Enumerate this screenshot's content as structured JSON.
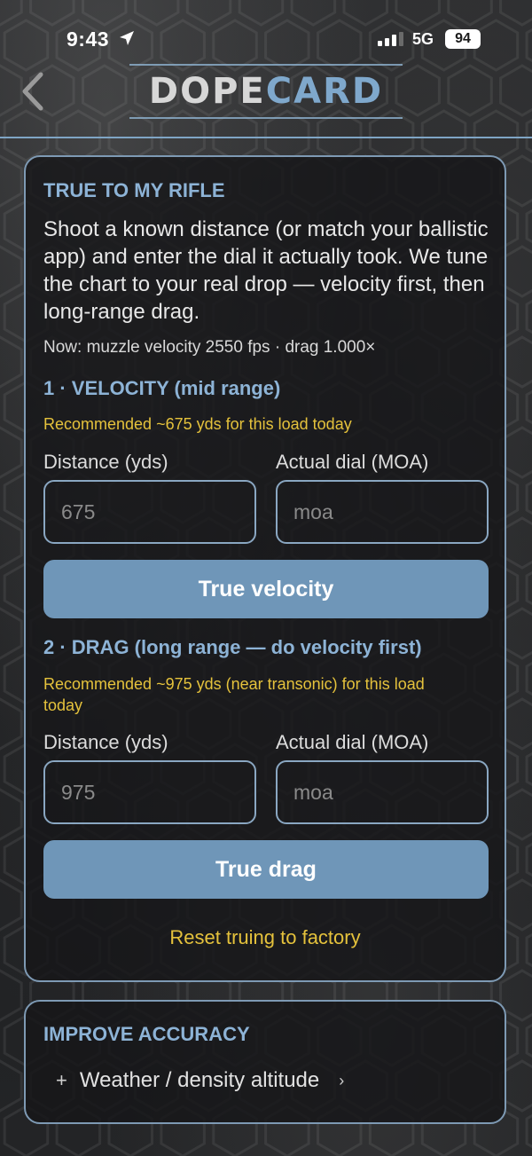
{
  "status_bar": {
    "time": "9:43",
    "network": "5G",
    "battery": "94"
  },
  "header": {
    "logo_part1": "DOPE",
    "logo_part2": "CARD"
  },
  "true_to_rifle": {
    "title": "TRUE TO MY RIFLE",
    "intro": "Shoot a known distance (or match your ballistic app) and enter the dial it actually took. We tune the chart to your real drop — velocity first, then long-range drag.",
    "now": "Now: muzzle velocity 2550 fps · drag 1.000×",
    "velocity": {
      "heading": "1 · VELOCITY (mid range)",
      "recommendation": "Recommended ~675 yds for this load today",
      "distance_label": "Distance (yds)",
      "dial_label": "Actual dial (MOA)",
      "distance_placeholder": "675",
      "dial_placeholder": "moa",
      "button": "True velocity"
    },
    "drag": {
      "heading": "2 · DRAG (long range — do velocity first)",
      "recommendation": "Recommended ~975 yds (near transonic) for this load today",
      "distance_label": "Distance (yds)",
      "dial_label": "Actual dial (MOA)",
      "distance_placeholder": "975",
      "dial_placeholder": "moa",
      "button": "True drag"
    },
    "reset": "Reset truing to factory"
  },
  "improve_accuracy": {
    "title": "IMPROVE ACCURACY",
    "item_plus": "+",
    "item_label": "Weather / density altitude",
    "item_chevron": "›"
  },
  "colors": {
    "accent": "#8db3d6",
    "button": "#6f96b8",
    "warning": "#e5c23c",
    "border": "#7e9ab4"
  }
}
